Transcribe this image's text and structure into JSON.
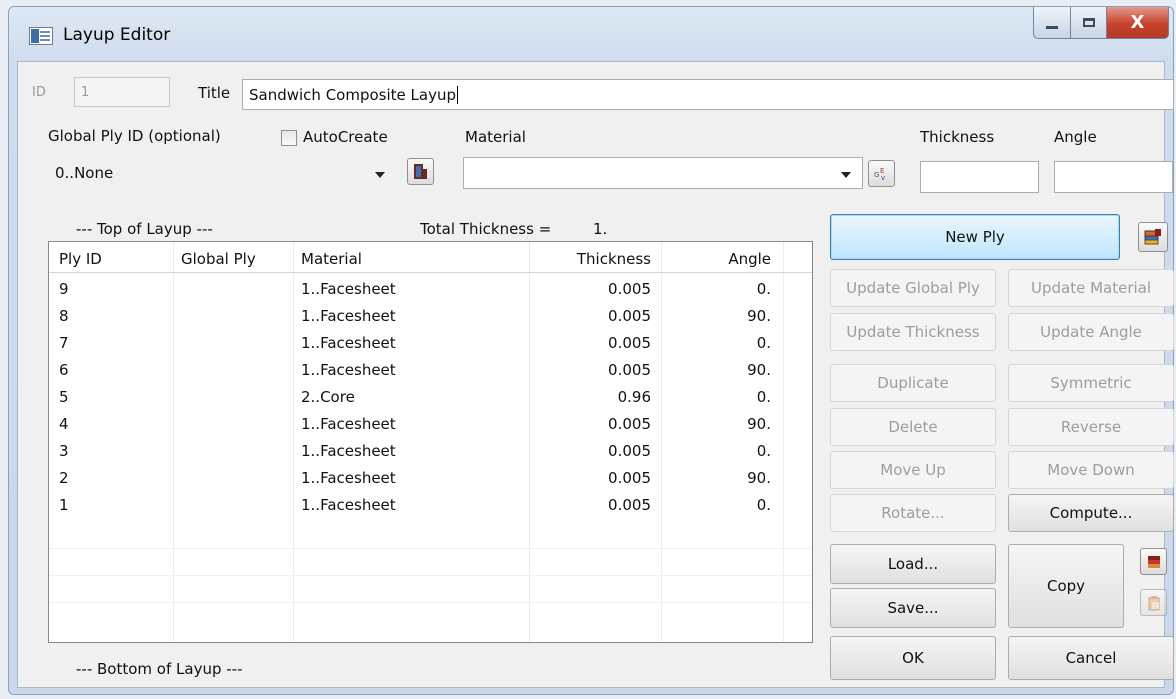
{
  "window": {
    "title": "Layup Editor",
    "minimize_label": "",
    "maximize_label": "",
    "close_label": "X"
  },
  "header": {
    "id_label": "ID",
    "id_value": "1",
    "title_label": "Title",
    "title_value": "Sandwich Composite Layup"
  },
  "ply_controls": {
    "global_ply_label": "Global Ply ID (optional)",
    "global_ply_value": "0..None",
    "autocreate_label": "AutoCreate",
    "autocreate_checked": false,
    "material_label": "Material",
    "material_value": "",
    "thickness_label": "Thickness",
    "thickness_value": "",
    "angle_label": "Angle",
    "angle_value": ""
  },
  "layup": {
    "top_label": "--- Top of Layup ---",
    "bottom_label": "--- Bottom of Layup ---",
    "total_thickness_label": "Total Thickness =",
    "total_thickness_value": "1."
  },
  "table": {
    "columns": [
      "Ply ID",
      "Global Ply",
      "Material",
      "Thickness",
      "Angle"
    ],
    "rows": [
      {
        "ply_id": "9",
        "global_ply": "",
        "material": "1..Facesheet",
        "thickness": "0.005",
        "angle": "0."
      },
      {
        "ply_id": "8",
        "global_ply": "",
        "material": "1..Facesheet",
        "thickness": "0.005",
        "angle": "90."
      },
      {
        "ply_id": "7",
        "global_ply": "",
        "material": "1..Facesheet",
        "thickness": "0.005",
        "angle": "0."
      },
      {
        "ply_id": "6",
        "global_ply": "",
        "material": "1..Facesheet",
        "thickness": "0.005",
        "angle": "90."
      },
      {
        "ply_id": "5",
        "global_ply": "",
        "material": "2..Core",
        "thickness": "0.96",
        "angle": "0."
      },
      {
        "ply_id": "4",
        "global_ply": "",
        "material": "1..Facesheet",
        "thickness": "0.005",
        "angle": "90."
      },
      {
        "ply_id": "3",
        "global_ply": "",
        "material": "1..Facesheet",
        "thickness": "0.005",
        "angle": "0."
      },
      {
        "ply_id": "2",
        "global_ply": "",
        "material": "1..Facesheet",
        "thickness": "0.005",
        "angle": "90."
      },
      {
        "ply_id": "1",
        "global_ply": "",
        "material": "1..Facesheet",
        "thickness": "0.005",
        "angle": "0."
      }
    ]
  },
  "buttons": {
    "new_ply": "New Ply",
    "update_global_ply": "Update Global Ply",
    "update_material": "Update Material",
    "update_thickness": "Update Thickness",
    "update_angle": "Update Angle",
    "duplicate": "Duplicate",
    "symmetric": "Symmetric",
    "delete": "Delete",
    "reverse": "Reverse",
    "move_up": "Move Up",
    "move_down": "Move Down",
    "rotate": "Rotate...",
    "compute": "Compute...",
    "load": "Load...",
    "save": "Save...",
    "copy": "Copy",
    "ok": "OK",
    "cancel": "Cancel"
  },
  "icons": {
    "app": "layup-editor-app-icon",
    "global_ply_browse": "ply-browse-icon",
    "material_browse": "material-browse-icon",
    "new_ply_side": "stack-icon",
    "copy_side": "copy-stack-icon",
    "paste_side": "paste-icon"
  },
  "colors": {
    "accent": "#3c7fb1",
    "primary_button": "#bee6fd",
    "close_button": "#c7402b",
    "disabled_text": "#9d9d9d"
  }
}
